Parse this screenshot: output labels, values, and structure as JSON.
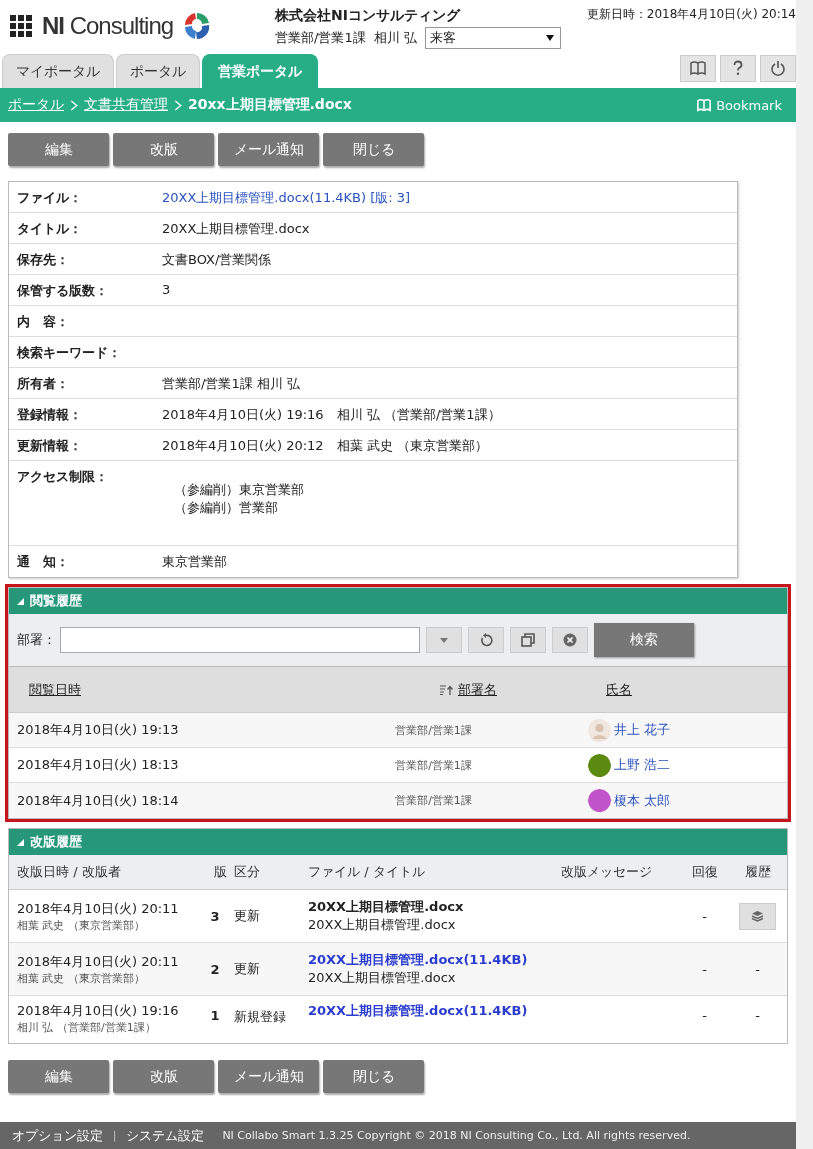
{
  "header": {
    "logo_bold": "NI",
    "logo_text": "Consulting",
    "company": "株式会社NIコンサルティング",
    "user_dept": "営業部/営業1課",
    "user_name": "相川 弘",
    "status_select": "来客",
    "updated": "更新日時：2018年4月10日(火) 20:14"
  },
  "tabs": [
    {
      "label": "マイポータル",
      "selected": false
    },
    {
      "label": "ポータル",
      "selected": false
    },
    {
      "label": "営業ポータル",
      "selected": true
    }
  ],
  "breadcrumb": {
    "links": [
      "ポータル",
      "文書共有管理"
    ],
    "current": "20xx上期目標管理.docx",
    "bookmark": "Bookmark"
  },
  "top_buttons": [
    "編集",
    "改版",
    "メール通知",
    "閉じる"
  ],
  "details": [
    {
      "label": "ファイル：",
      "kind": "link",
      "value": "20XX上期目標管理.docx(11.4KB) [版: 3]"
    },
    {
      "label": "タイトル：",
      "kind": "text",
      "value": "20XX上期目標管理.docx"
    },
    {
      "label": "保存先：",
      "kind": "text",
      "value": "文書BOX/営業関係"
    },
    {
      "label": "保管する版数：",
      "kind": "text",
      "value": "3"
    },
    {
      "label": "内　容：",
      "kind": "text"
    },
    {
      "label": "検索キーワード：",
      "kind": "text"
    },
    {
      "label": "所有者：",
      "kind": "text",
      "value": "営業部/営業1課 相川 弘"
    },
    {
      "label": "登録情報：",
      "kind": "text",
      "value": "2018年4月10日(火) 19:16　相川 弘 （営業部/営業1課）"
    },
    {
      "label": "更新情報：",
      "kind": "text",
      "value": "2018年4月10日(火) 20:12　相葉 武史 （東京営業部）"
    },
    {
      "label": "アクセス制限：",
      "kind": "list",
      "values": [
        "（参編削）東京営業部",
        "（参編削）営業部"
      ]
    },
    {
      "label": "通　知：",
      "kind": "text",
      "value": "東京営業部"
    }
  ],
  "view_history": {
    "title": "閲覧履歴",
    "highlighted": true,
    "filter_label": "部署：",
    "search_button": "検索",
    "columns": [
      {
        "label": "閲覧日時",
        "sorted": false
      },
      {
        "label": "部署名",
        "sorted": true
      },
      {
        "label": "氏名",
        "sorted": false
      }
    ],
    "rows": [
      {
        "date": "2018年4月10日(火) 19:13",
        "dept": "営業部/営業1課",
        "name": "井上 花子",
        "color": "#efe6de"
      },
      {
        "date": "2018年4月10日(火) 18:13",
        "dept": "営業部/営業1課",
        "name": "上野 浩二",
        "color": "#5a8a10"
      },
      {
        "date": "2018年4月10日(火) 18:14",
        "dept": "営業部/営業1課",
        "name": "榎本 太郎",
        "color": "#c054c8"
      }
    ]
  },
  "revision_history": {
    "title": "改版履歴",
    "columns": [
      "改版日時 / 改版者",
      "版",
      "区分",
      "ファイル / タイトル",
      "改版メッセージ",
      "回復",
      "履歴"
    ],
    "rows": [
      {
        "date": "2018年4月10日(火) 20:11",
        "author": "相葉 武史 （東京営業部）",
        "version": "3",
        "type": "更新",
        "file": "20XX上期目標管理.docx",
        "file_link": false,
        "title": "20XX上期目標管理.docx",
        "restore": "-",
        "kind": "button"
      },
      {
        "date": "2018年4月10日(火) 20:11",
        "author": "相葉 武史 （東京営業部）",
        "version": "2",
        "type": "更新",
        "file": "20XX上期目標管理.docx(11.4KB)",
        "file_link": true,
        "title": "20XX上期目標管理.docx",
        "restore": "-",
        "kind": "text",
        "history": "-"
      },
      {
        "date": "2018年4月10日(火) 19:16",
        "author": "相川 弘 （営業部/営業1課）",
        "version": "1",
        "type": "新規登録",
        "file": "20XX上期目標管理.docx(11.4KB)",
        "file_link": true,
        "restore": "-",
        "kind": "text",
        "history": "-"
      }
    ]
  },
  "bottom_buttons": [
    "編集",
    "改版",
    "メール通知",
    "閉じる"
  ],
  "footer": {
    "links": [
      "オプション設定",
      "システム設定"
    ],
    "separator": "|",
    "copyright": "NI Collabo Smart 1.3.25 Copyright © 2018 NI Consulting Co., Ltd. All rights reserved."
  }
}
